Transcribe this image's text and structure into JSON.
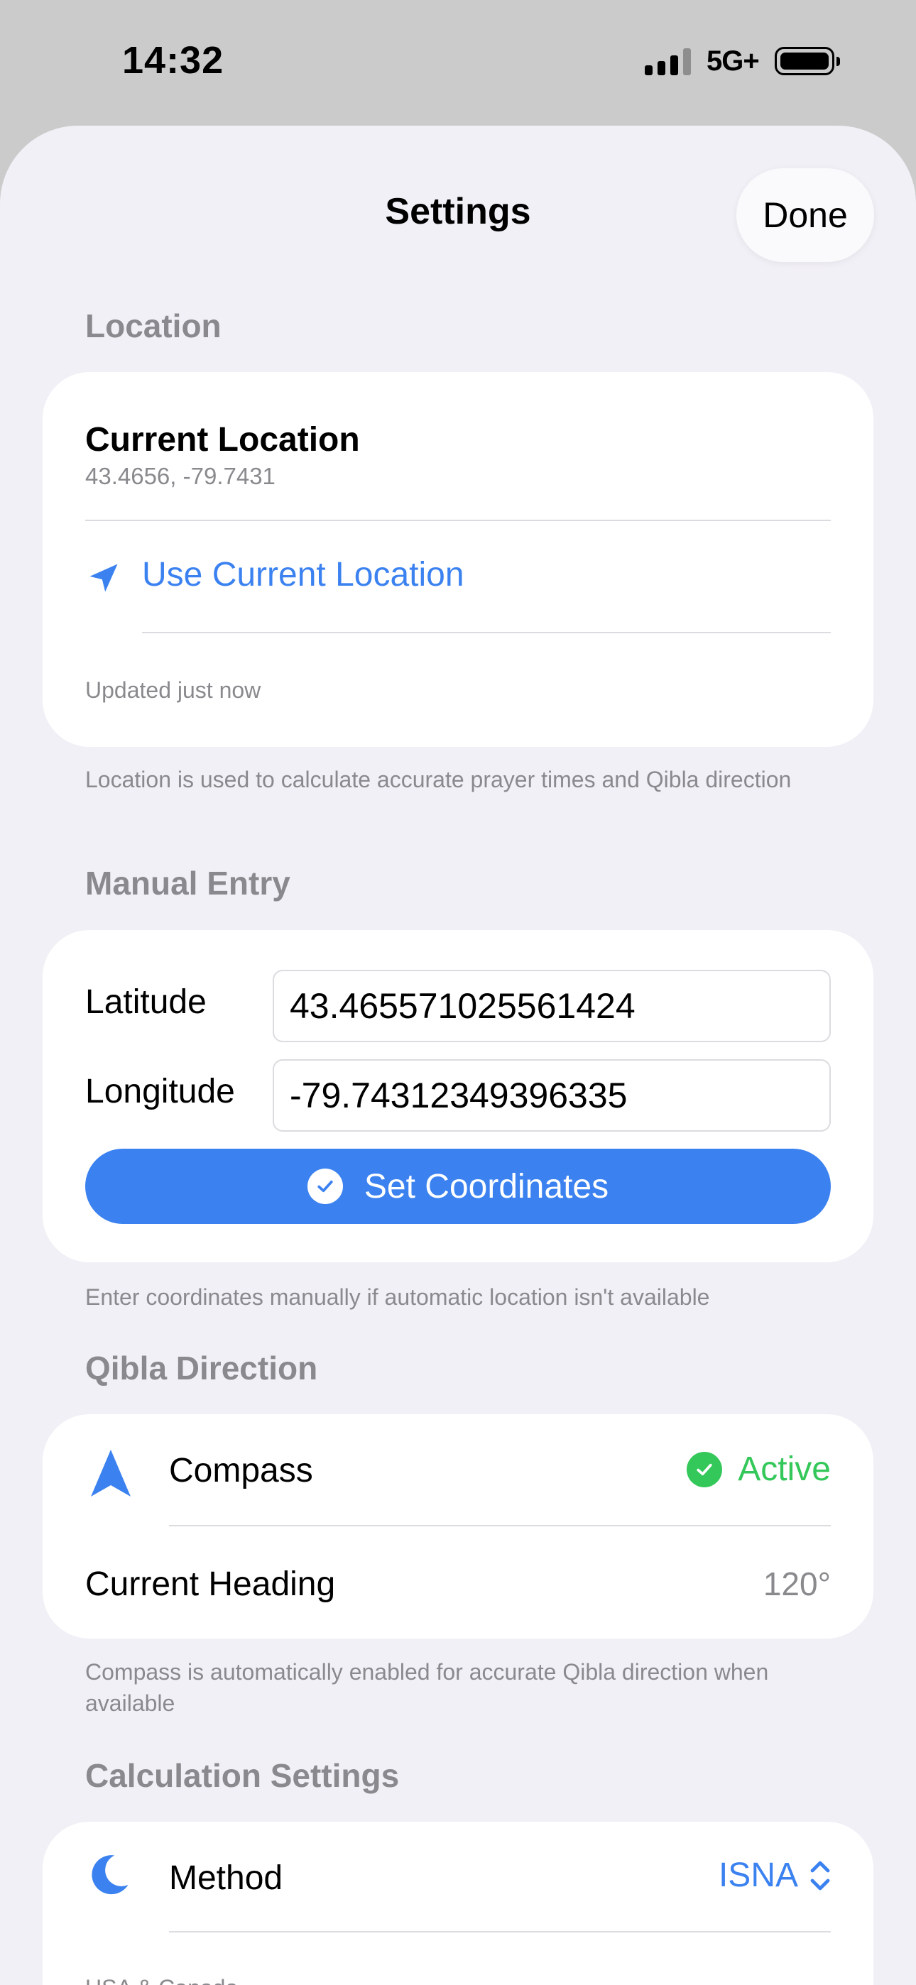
{
  "status_bar": {
    "time": "14:32",
    "network": "5G+"
  },
  "header": {
    "title": "Settings",
    "done_label": "Done"
  },
  "location": {
    "section_title": "Location",
    "current_title": "Current Location",
    "coords": "43.4656, -79.7431",
    "use_current_label": "Use Current Location",
    "updated": "Updated just now",
    "footer": "Location is used to calculate accurate prayer times and Qibla direction"
  },
  "manual": {
    "section_title": "Manual Entry",
    "latitude_label": "Latitude",
    "latitude_value": "43.465571025561424",
    "longitude_label": "Longitude",
    "longitude_value": "-79.74312349396335",
    "set_button": "Set Coordinates",
    "footer": "Enter coordinates manually if automatic location isn't available"
  },
  "qibla": {
    "section_title": "Qibla Direction",
    "compass_label": "Compass",
    "compass_status": "Active",
    "heading_label": "Current Heading",
    "heading_value": "120°",
    "footer": "Compass is automatically enabled for accurate Qibla direction when available"
  },
  "calculation": {
    "section_title": "Calculation Settings",
    "method_label": "Method",
    "method_value": "ISNA",
    "method_description": "USA & Canada"
  },
  "colors": {
    "accent": "#3b82f0",
    "success": "#34c759",
    "secondary_text": "#8a8a8e"
  }
}
